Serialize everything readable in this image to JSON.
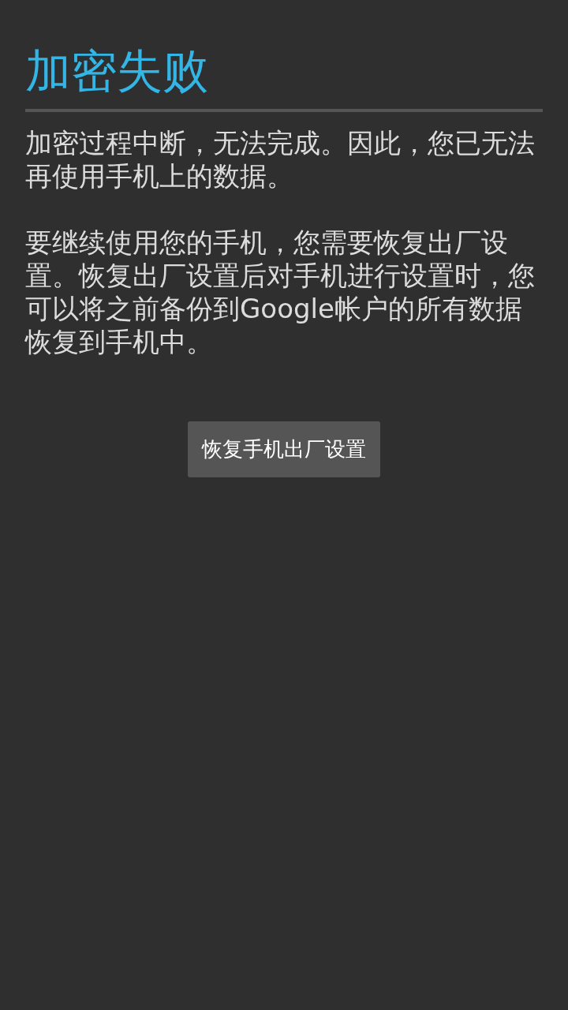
{
  "title": "加密失败",
  "paragraphs": [
    "加密过程中断，无法完成。因此，您已无法再使用手机上的数据。",
    "要继续使用您的手机，您需要恢复出厂设置。恢复出厂设置后对手机进行设置时，您可以将之前备份到Google帐户的所有数据恢复到手机中。"
  ],
  "button": "恢复手机出厂设置"
}
